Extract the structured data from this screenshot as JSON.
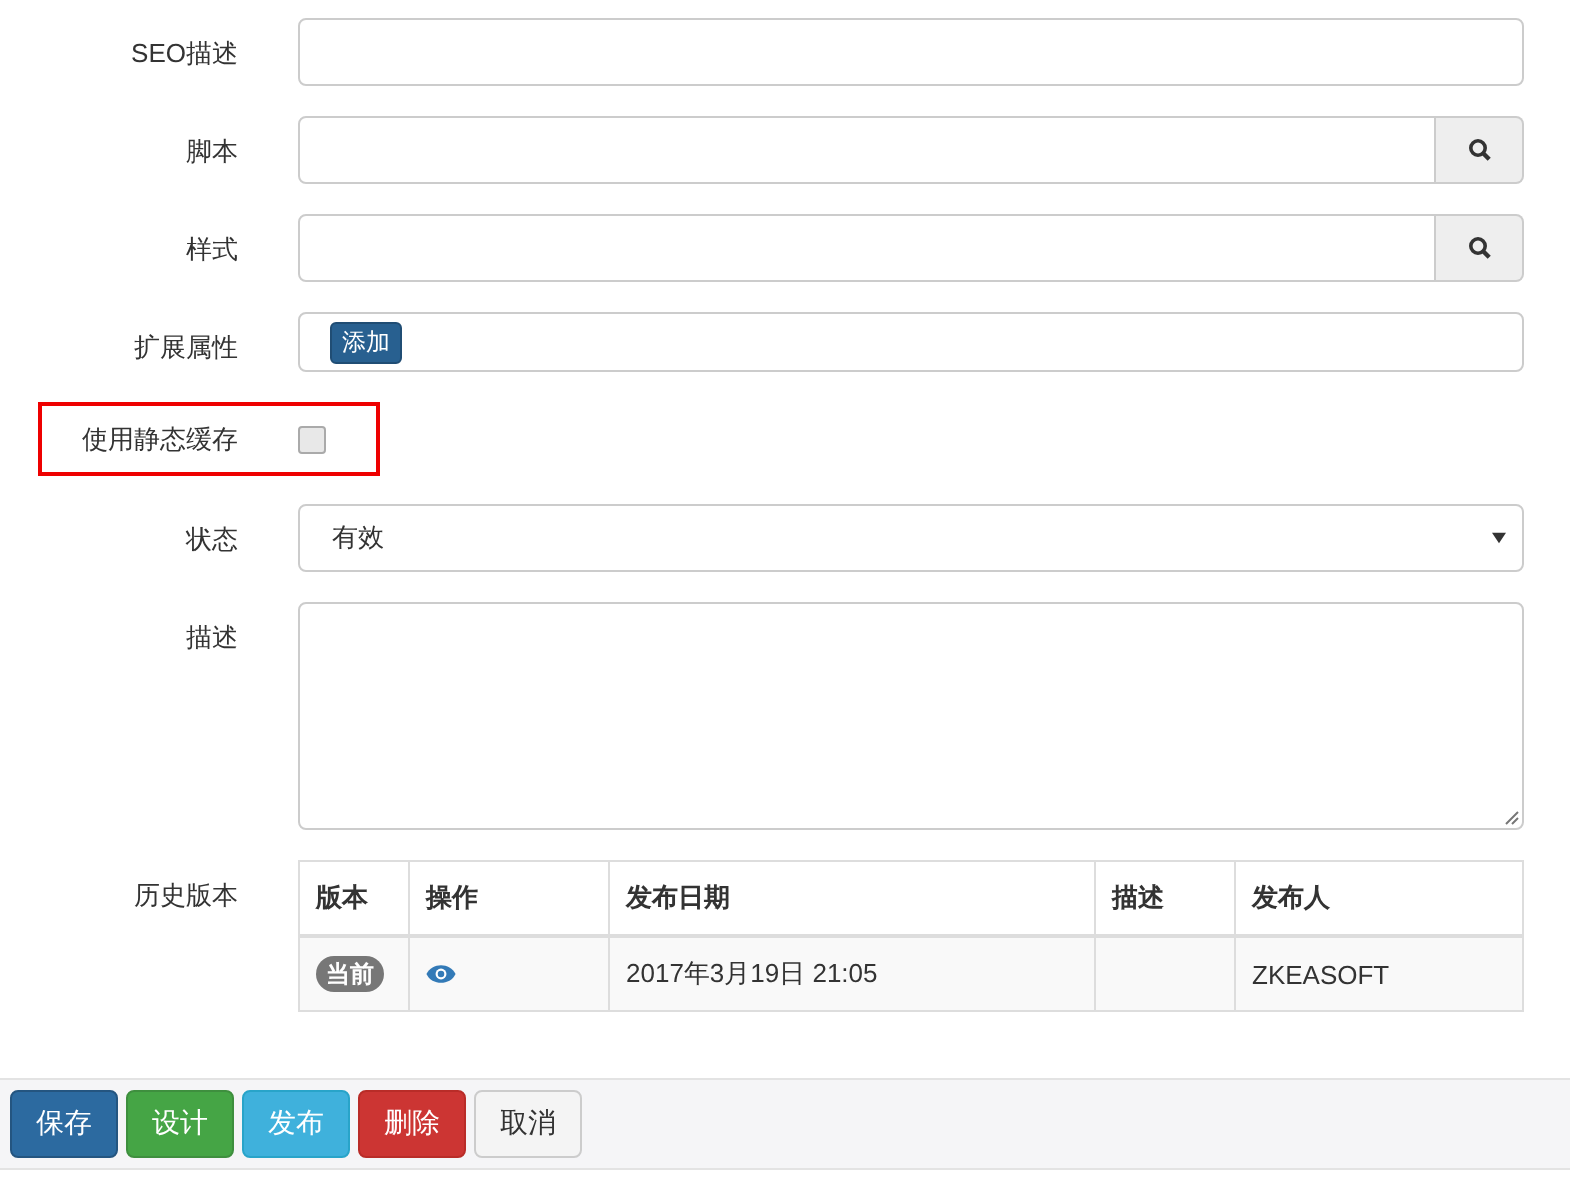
{
  "form": {
    "fields": [
      {
        "kind": "text",
        "label": "SEO描述"
      },
      {
        "kind": "lookup",
        "label": "脚本"
      },
      {
        "kind": "lookup",
        "label": "样式"
      },
      {
        "kind": "tags",
        "label": "扩展属性",
        "button": "添加"
      },
      {
        "kind": "checkbox",
        "label": "使用静态缓存",
        "checked": false,
        "highlighted": true
      },
      {
        "kind": "select",
        "label": "状态",
        "value": "有效"
      },
      {
        "kind": "textarea",
        "label": "描述"
      },
      {
        "kind": "table",
        "label": "历史版本"
      }
    ]
  },
  "history": {
    "columns": [
      "版本",
      "操作",
      "发布日期",
      "描述",
      "发布人"
    ],
    "rows": [
      {
        "version": "当前",
        "date": "2017年3月19日 21:05",
        "description": "",
        "publisher": "ZKEASOFT"
      }
    ]
  },
  "actions": [
    {
      "label": "保存",
      "kind": "primary"
    },
    {
      "label": "设计",
      "kind": "success"
    },
    {
      "label": "发布",
      "kind": "info"
    },
    {
      "label": "删除",
      "kind": "danger"
    },
    {
      "label": "取消",
      "kind": "default"
    }
  ]
}
